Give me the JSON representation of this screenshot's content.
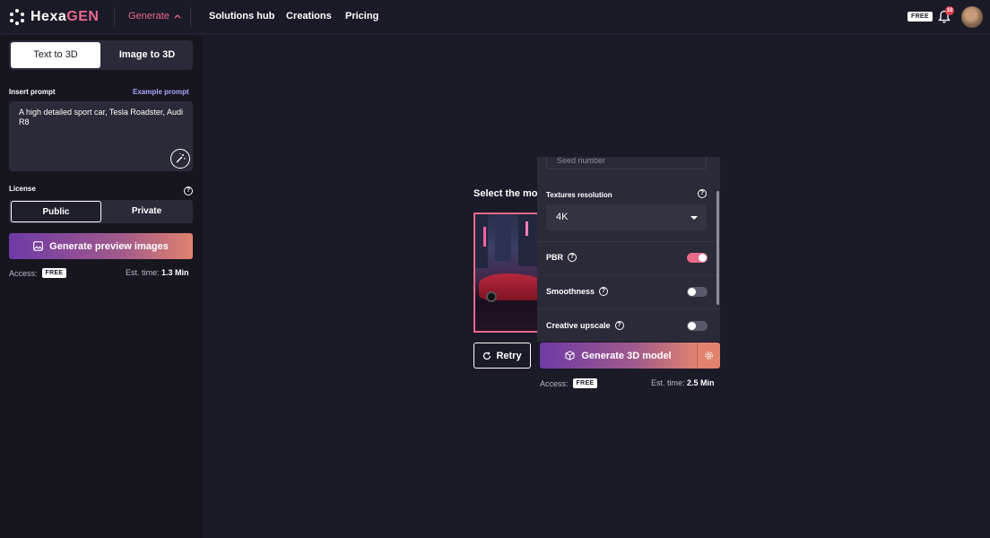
{
  "app": {
    "logo_main": "Hexa",
    "logo_accent": "GEN"
  },
  "nav": {
    "generate": "Generate",
    "solutions": "Solutions hub",
    "creations": "Creations",
    "pricing": "Pricing",
    "plan_badge": "FREE",
    "notification_count": "10"
  },
  "sidebar": {
    "tabs": [
      "Text to 3D",
      "Image to 3D"
    ],
    "prompt_label": "Insert prompt",
    "example_prompt": "Example prompt",
    "prompt_value": "A high detailed sport car, Tesla Roadster, Audi R8",
    "license_label": "License",
    "license_options": [
      "Public",
      "Private"
    ],
    "generate_button": "Generate preview images",
    "access_label": "Access:",
    "access_badge": "FREE",
    "est_label": "Est. time:",
    "est_value": "1.3 Min"
  },
  "main": {
    "select_title": "Select the mo",
    "retry_button": "Retry",
    "generate_button": "Generate 3D model",
    "access_label": "Access:",
    "access_badge": "FREE",
    "est_label": "Est. time:",
    "est_value": "2.5 Min"
  },
  "panel": {
    "seed_placeholder": "Seed number",
    "textures_label": "Textures resolution",
    "textures_value": "4K",
    "pbr_label": "PBR",
    "pbr_on": true,
    "smoothness_label": "Smoothness",
    "smoothness_on": false,
    "upscale_label": "Creative upscale",
    "upscale_on": false
  },
  "colors": {
    "background": "#1b1a27",
    "sidebar": "#17161f",
    "accent_pink": "#e86a8a",
    "link_purple": "#a9a8ff",
    "gradient_start": "#6e3aa6",
    "gradient_end": "#e0826e"
  }
}
